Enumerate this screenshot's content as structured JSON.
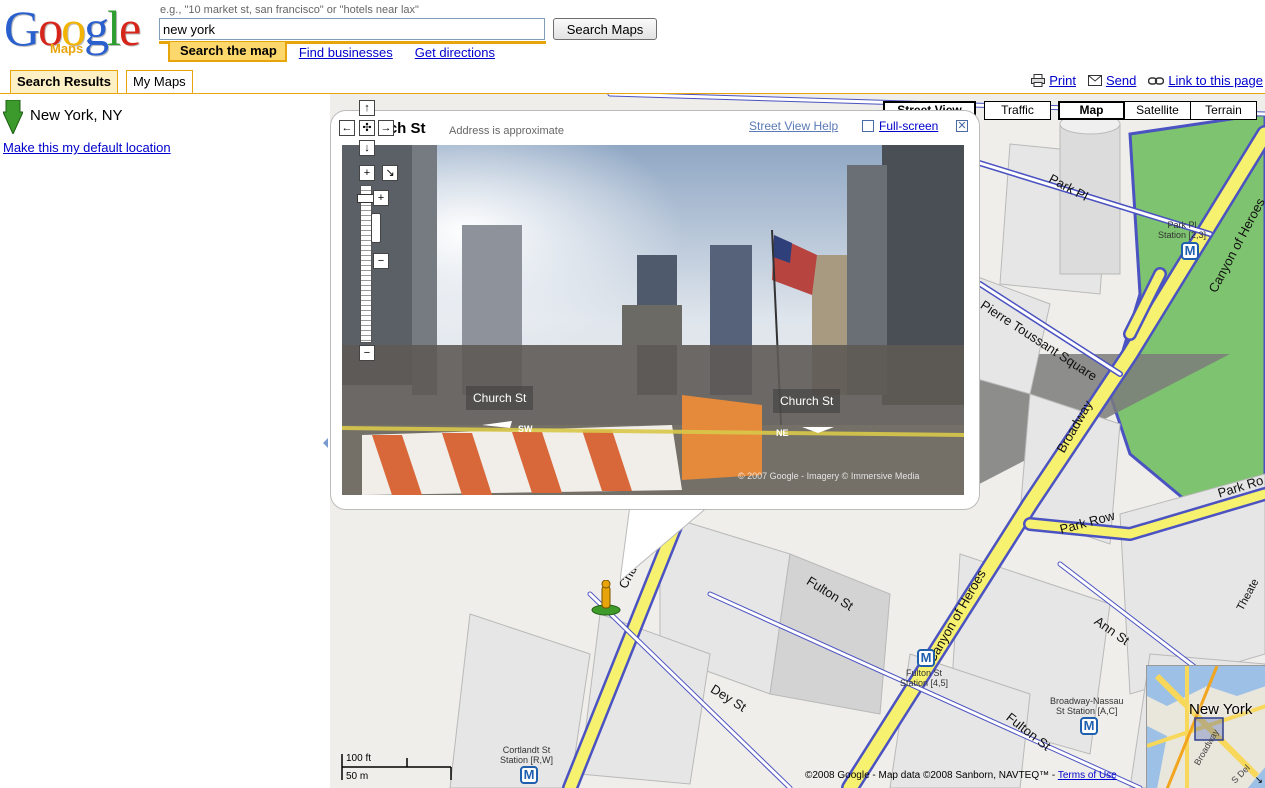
{
  "header": {
    "logo_text": "Google",
    "logo_sub": "Maps",
    "search_hint": "e.g., \"10 market st, san francisco\" or \"hotels near lax\"",
    "search_value": "new york",
    "search_button": "Search Maps",
    "tabs": {
      "search_map": "Search the map",
      "find_businesses": "Find businesses",
      "get_directions": "Get directions"
    }
  },
  "panel_tabs": {
    "search_results": "Search Results",
    "my_maps": "My Maps"
  },
  "util_links": {
    "print": "Print",
    "send": "Send",
    "link": "Link to this page"
  },
  "results": {
    "location": "New York, NY",
    "default_link": "Make this my default location"
  },
  "map_types": {
    "street_view": "Street View",
    "traffic": "Traffic",
    "map": "Map",
    "satellite": "Satellite",
    "terrain": "Terrain"
  },
  "info_window": {
    "title": "rch St",
    "subtitle": "Address is approximate",
    "help": "Street View Help",
    "fullscreen": "Full-screen",
    "pano_label_left": "Church St",
    "pano_label_right": "Church St",
    "compass_left": "SW",
    "compass_right": "NE",
    "pano_copyright": "© 2007 Google - Imagery © Immersive Media"
  },
  "map_labels": {
    "park_pl": "Park Pl",
    "canyon_top": "Canyon of Heroes",
    "park_pl_station": "Park Pl\nStation [2,3]",
    "pierre": "Pierre Toussant Square",
    "broadway": "Broadway",
    "park_row": "Park Row",
    "park_row_2": "Park Ro",
    "canyon_bottom": "Canyon of Heroes",
    "fulton_st": "Fulton St",
    "fulton_st_2": "Fulton St",
    "fulton_station": "Fulton St\nStation [4,5]",
    "ann_st": "Ann St",
    "broadway_nassau": "Broadway-Nassau\nSt Station [A,C]",
    "dey_st": "Dey St",
    "cortlandt": "Cortlandt St\nStation [R,W]",
    "church": "Chu",
    "theater": "Theate",
    "metro_icon": "M"
  },
  "scale": {
    "feet": "100 ft",
    "meters": "50 m"
  },
  "copyright": {
    "text": "©2008 Google - Map data ©2008 Sanborn, NAVTEQ™ - ",
    "terms": "Terms of Use"
  },
  "overview": {
    "label": "New York",
    "road": "Broadway",
    "road_2": "S Del"
  },
  "colors": {
    "road": "#f7f170",
    "road_outline": "#4b52c1",
    "park": "#7ec36f",
    "accent": "#e8a40b"
  }
}
